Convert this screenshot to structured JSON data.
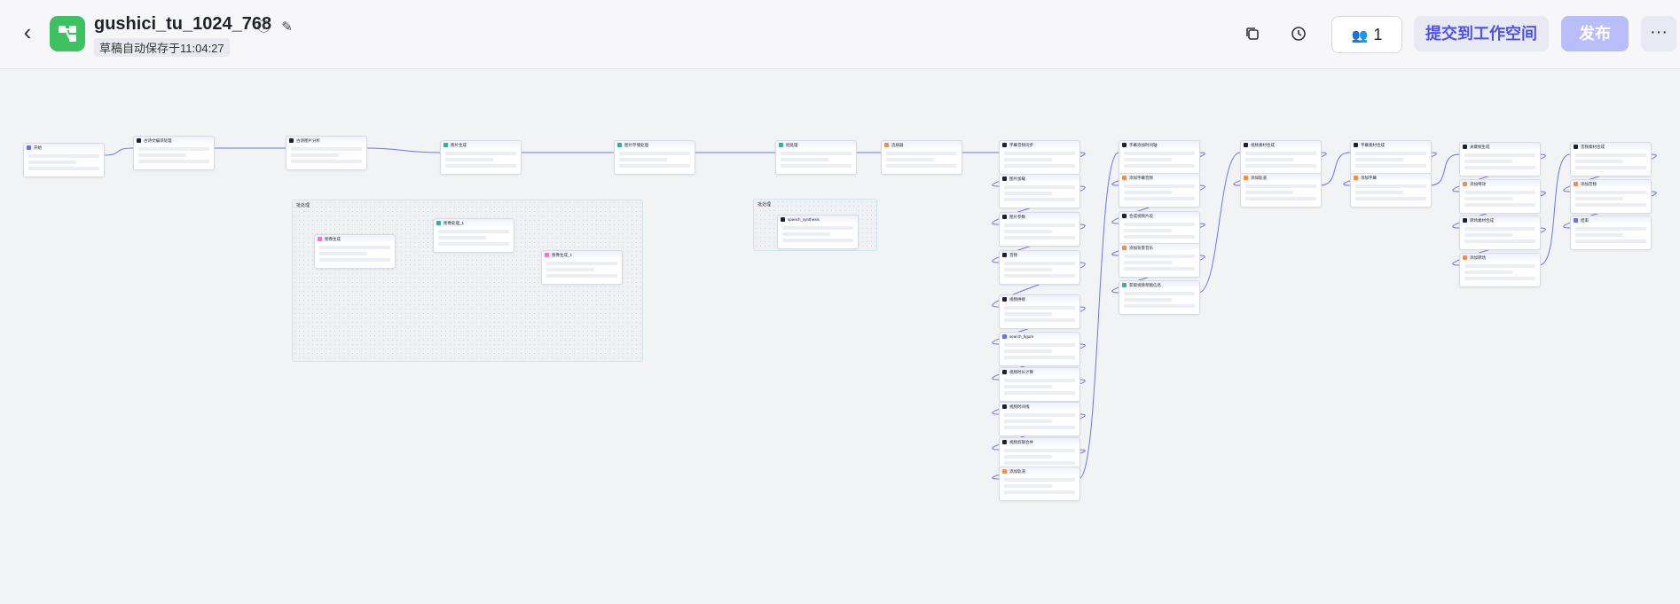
{
  "header": {
    "back_icon": "chevron-left-icon",
    "app_icon": "workflow-icon",
    "title": "gushici_tu_1024_768",
    "info_icon": "info-icon",
    "edit_icon": "edit-icon",
    "autosave": "草稿自动保存于11:04:27",
    "copy_icon": "copy-icon",
    "history_icon": "history-icon",
    "collaborators_icon": "users-icon",
    "collaborators_count": "1",
    "submit_label": "提交到工作空间",
    "publish_label": "发布",
    "more_label": "···"
  },
  "colors": {
    "accent": "#4d53e8",
    "logo": "#3ec160",
    "publish_disabled": "#b9bdfa",
    "wire": "#6f74e8"
  },
  "canvas": {
    "groups": [
      {
        "label": "批处理"
      },
      {
        "label": "批处理"
      }
    ],
    "nodes": [
      {
        "label": "开始",
        "icon_color": "#6a6ef0"
      },
      {
        "label": "古诗文编译处理",
        "icon_color": "#1f2329"
      },
      {
        "label": "古诗图片分析",
        "icon_color": "#1f2329"
      },
      {
        "label": "图片生成",
        "icon_color": "#2bb3a6"
      },
      {
        "label": "图片存储处理",
        "icon_color": "#2bb3a6"
      },
      {
        "label": "批处理",
        "icon_color": "#2bb3a6"
      },
      {
        "label": "选择器",
        "icon_color": "#ff8a3d"
      },
      {
        "label": "图像生成",
        "icon_color": "#ff6fc8"
      },
      {
        "label": "图像处理_1",
        "icon_color": "#2bb3a6"
      },
      {
        "label": "图像生成_1",
        "icon_color": "#ff6fc8"
      },
      {
        "label": "speech_synthesis",
        "icon_color": "#1f2329"
      },
      {
        "label": "字幕音频同步",
        "icon_color": "#1f2329"
      },
      {
        "label": "图片加载",
        "icon_color": "#1f2329"
      },
      {
        "label": "图片参数",
        "icon_color": "#1f2329"
      },
      {
        "label": "音频",
        "icon_color": "#1f2329"
      },
      {
        "label": "视频拼接",
        "icon_color": "#1f2329"
      },
      {
        "label": "search_figure",
        "icon_color": "#6a6ef0"
      },
      {
        "label": "视频时长计算",
        "icon_color": "#1f2329"
      },
      {
        "label": "视频时间线",
        "icon_color": "#1f2329"
      },
      {
        "label": "视频剪辑合并",
        "icon_color": "#1f2329"
      },
      {
        "label": "添加轨道",
        "icon_color": "#ff8a3d"
      },
      {
        "label": "字幕添加时间轴",
        "icon_color": "#1f2329"
      },
      {
        "label": "添加字幕音频",
        "icon_color": "#ff8a3d"
      },
      {
        "label": "合成视频片段",
        "icon_color": "#1f2329"
      },
      {
        "label": "添加背景音乐",
        "icon_color": "#ff8a3d"
      },
      {
        "label": "获取视频草稿信息",
        "icon_color": "#2bb3a6"
      },
      {
        "label": "视频素材合成",
        "icon_color": "#1f2329"
      },
      {
        "label": "添加轨道",
        "icon_color": "#ff8a3d"
      },
      {
        "label": "字幕素材合成",
        "icon_color": "#1f2329"
      },
      {
        "label": "添加字幕",
        "icon_color": "#ff8a3d"
      },
      {
        "label": "关键帧生成",
        "icon_color": "#1f2329"
      },
      {
        "label": "添加特效",
        "icon_color": "#ff8a3d"
      },
      {
        "label": "转场素材合成",
        "icon_color": "#1f2329"
      },
      {
        "label": "添加转场",
        "icon_color": "#ff8a3d"
      },
      {
        "label": "音频素材合成",
        "icon_color": "#1f2329"
      },
      {
        "label": "添加音频",
        "icon_color": "#ff8a3d"
      },
      {
        "label": "结束",
        "icon_color": "#6a6ef0"
      }
    ]
  }
}
